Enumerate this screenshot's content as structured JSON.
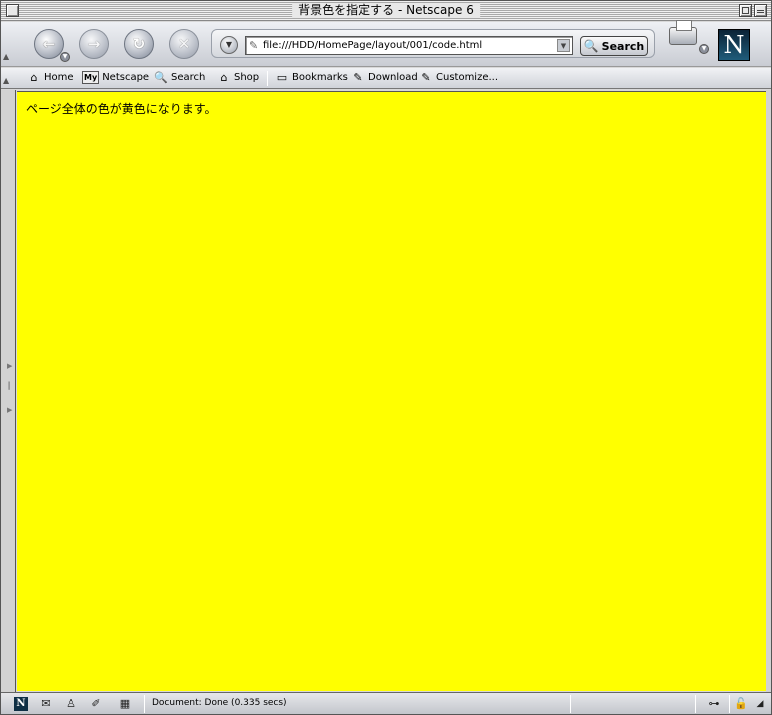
{
  "window": {
    "title": "背景色を指定する - Netscape 6"
  },
  "navbar": {
    "back_glyph": "←",
    "forward_glyph": "→",
    "reload_glyph": "↻",
    "stop_glyph": "✕",
    "url": "file:///HDD/HomePage/layout/001/code.html",
    "search_label": "Search",
    "logo_letter": "N"
  },
  "personal_toolbar": {
    "items": [
      {
        "label": "Home",
        "icon": "home-icon"
      },
      {
        "label": "Netscape",
        "icon": "my-netscape-icon",
        "icon_text": "My"
      },
      {
        "label": "Search",
        "icon": "search-icon"
      },
      {
        "label": "Shop",
        "icon": "shop-icon"
      },
      {
        "label": "Bookmarks",
        "icon": "folder-icon"
      },
      {
        "label": "Download",
        "icon": "bookmark-link-icon"
      },
      {
        "label": "Customize...",
        "icon": "bookmark-link-icon"
      }
    ]
  },
  "content": {
    "background_color": "#ffff00",
    "text": "ページ全体の色が黄色になります。"
  },
  "statusbar": {
    "status_text": "Document: Done (0.335 secs)",
    "n_icon_letter": "N"
  }
}
